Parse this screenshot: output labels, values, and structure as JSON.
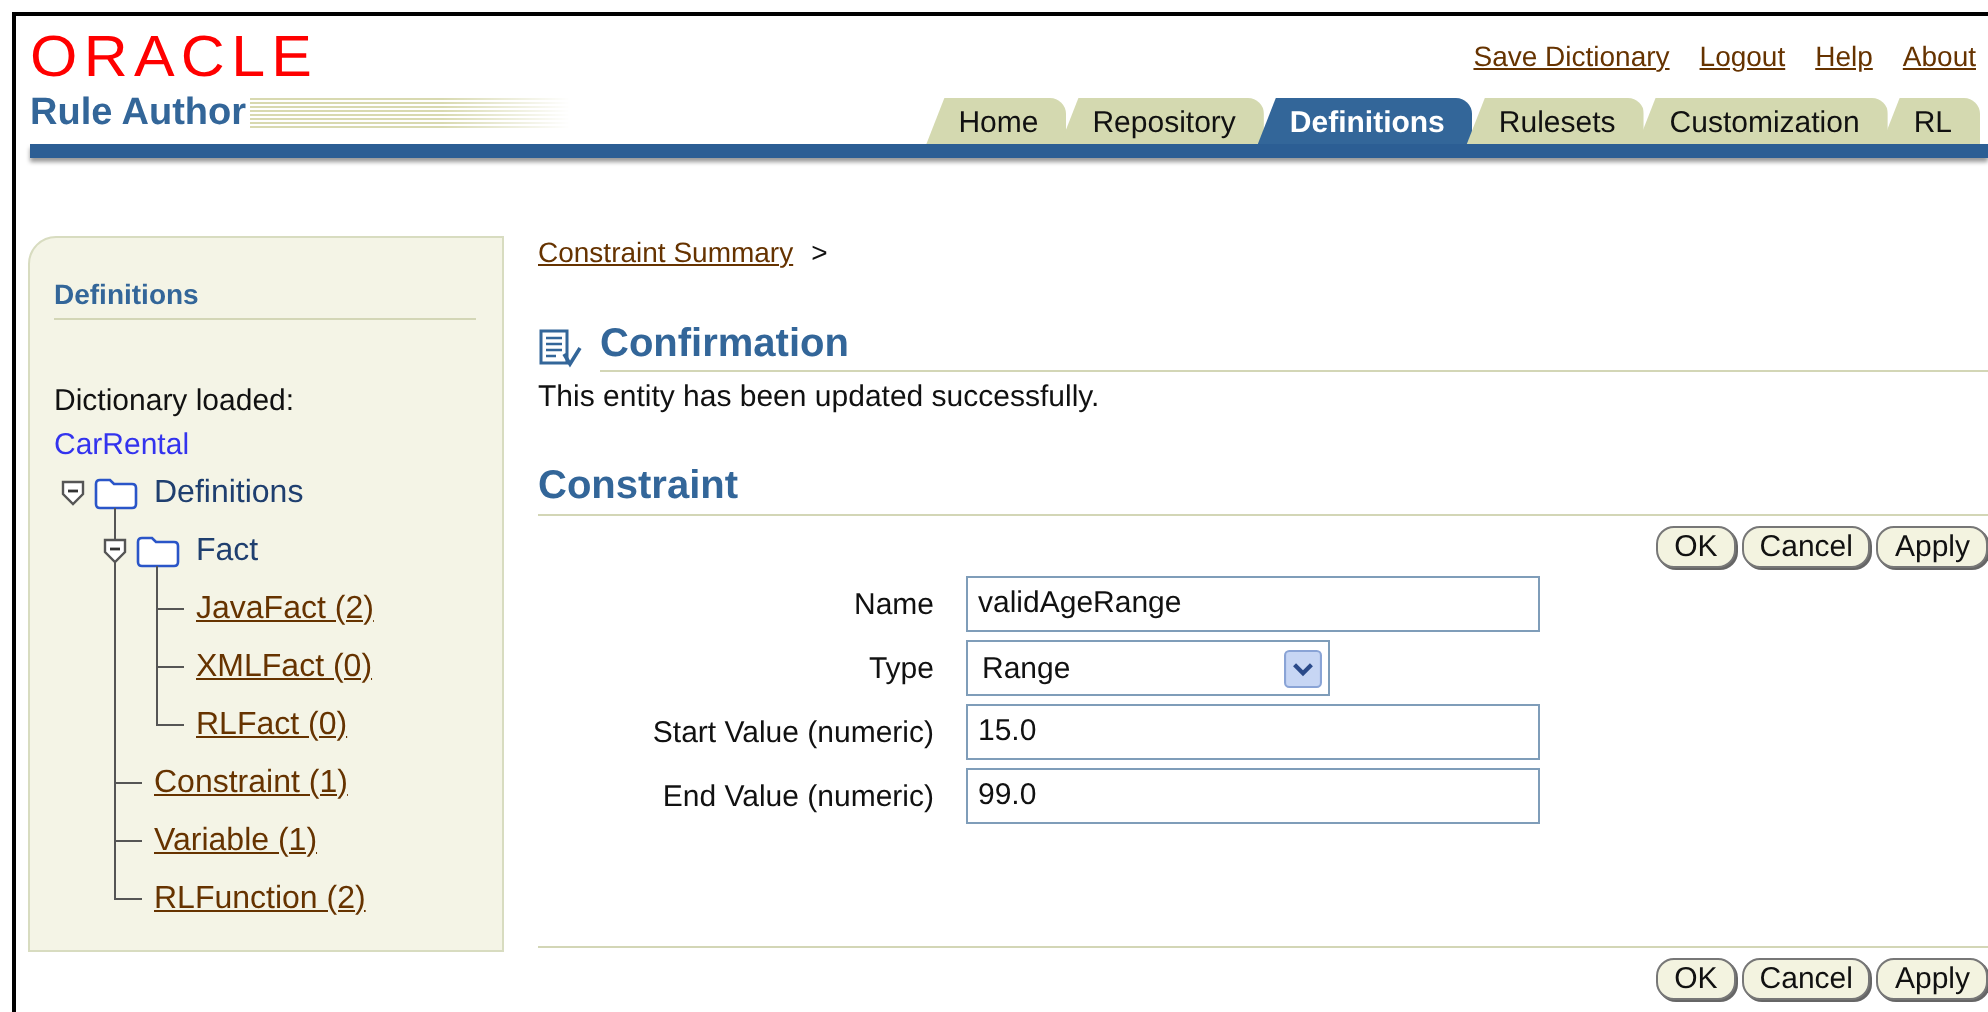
{
  "header": {
    "logo": "ORACLE",
    "app_title": "Rule Author",
    "global_links": [
      "Save Dictionary",
      "Logout",
      "Help",
      "About"
    ]
  },
  "tabs": [
    {
      "label": "Home",
      "selected": false
    },
    {
      "label": "Repository",
      "selected": false
    },
    {
      "label": "Definitions",
      "selected": true
    },
    {
      "label": "Rulesets",
      "selected": false
    },
    {
      "label": "Customization",
      "selected": false
    },
    {
      "label": "RL",
      "selected": false
    }
  ],
  "sidebar": {
    "title": "Definitions",
    "dictionary_label": "Dictionary loaded:",
    "dictionary_name": "CarRental",
    "tree": [
      {
        "label": "Definitions",
        "kind": "folder",
        "expanded": true,
        "children": [
          {
            "label": "Fact",
            "kind": "folder",
            "expanded": true,
            "children": [
              {
                "label": "JavaFact (2)",
                "kind": "link"
              },
              {
                "label": "XMLFact (0)",
                "kind": "link"
              },
              {
                "label": "RLFact (0)",
                "kind": "link"
              }
            ]
          },
          {
            "label": "Constraint (1)",
            "kind": "link"
          },
          {
            "label": "Variable (1)",
            "kind": "link"
          },
          {
            "label": "RLFunction (2)",
            "kind": "link"
          }
        ]
      }
    ]
  },
  "breadcrumb": {
    "link": "Constraint Summary",
    "separator": ">"
  },
  "confirmation": {
    "title": "Confirmation",
    "message": "This entity has been updated successfully."
  },
  "form": {
    "title": "Constraint",
    "buttons_top": [
      "OK",
      "Cancel",
      "Apply"
    ],
    "fields": [
      {
        "label": "Name",
        "kind": "text",
        "value": "validAgeRange"
      },
      {
        "label": "Type",
        "kind": "select",
        "value": "Range"
      },
      {
        "label": "Start Value (numeric)",
        "kind": "text",
        "value": "15.0"
      },
      {
        "label": "End Value (numeric)",
        "kind": "text",
        "value": "99.0"
      }
    ],
    "buttons_bottom": [
      "OK",
      "Cancel",
      "Apply"
    ]
  }
}
